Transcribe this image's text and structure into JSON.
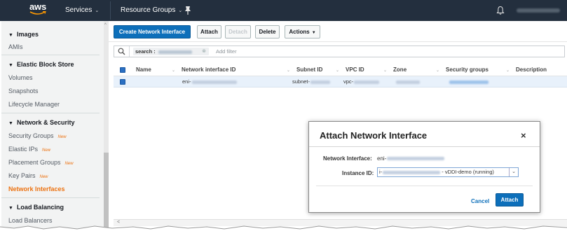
{
  "nav": {
    "logo": "aws",
    "services": "Services",
    "resource_groups": "Resource Groups"
  },
  "sidebar": {
    "sections": [
      {
        "title": "Images",
        "items": [
          {
            "label": "AMIs"
          }
        ]
      },
      {
        "title": "Elastic Block Store",
        "items": [
          {
            "label": "Volumes"
          },
          {
            "label": "Snapshots"
          },
          {
            "label": "Lifecycle Manager"
          }
        ]
      },
      {
        "title": "Network & Security",
        "items": [
          {
            "label": "Security Groups",
            "badge": "New"
          },
          {
            "label": "Elastic IPs",
            "badge": "New"
          },
          {
            "label": "Placement Groups",
            "badge": "New"
          },
          {
            "label": "Key Pairs",
            "badge": "New"
          },
          {
            "label": "Network Interfaces"
          }
        ]
      },
      {
        "title": "Load Balancing",
        "items": [
          {
            "label": "Load Balancers"
          }
        ]
      }
    ]
  },
  "toolbar": {
    "create": "Create Network Interface",
    "attach": "Attach",
    "detach": "Detach",
    "delete": "Delete",
    "actions": "Actions"
  },
  "filter": {
    "token_key": "search :",
    "placeholder": "Add filter"
  },
  "table": {
    "columns": [
      "Name",
      "Network interface ID",
      "Subnet ID",
      "VPC ID",
      "Zone",
      "Security groups",
      "Description"
    ],
    "row": {
      "eni_prefix": "eni-",
      "subnet_prefix": "subnet-",
      "vpc_prefix": "vpc-"
    }
  },
  "modal": {
    "title": "Attach Network Interface",
    "close": "×",
    "network_interface_label": "Network Interface:",
    "network_interface_prefix": "eni-",
    "instance_label": "Instance ID:",
    "instance_prefix": "i-",
    "instance_suffix": "- vDDI-demo (running)",
    "cancel": "Cancel",
    "attach": "Attach"
  },
  "colors": {
    "nav_bg": "#232f3e",
    "accent_orange": "#ec7211",
    "primary_blue": "#0d6fba"
  }
}
